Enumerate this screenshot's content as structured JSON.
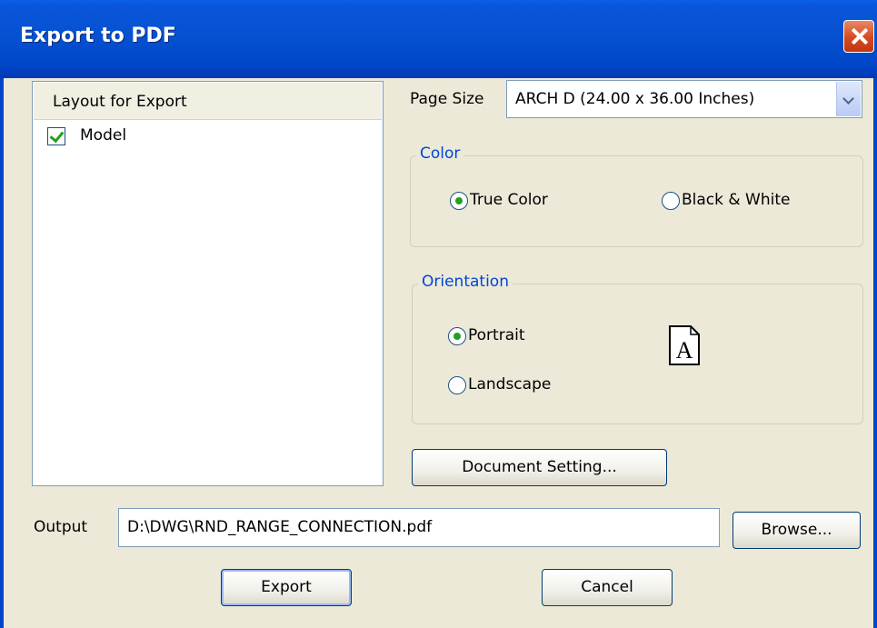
{
  "window": {
    "title": "Export to PDF"
  },
  "layout_list": {
    "header": "Layout for Export",
    "items": [
      {
        "label": "Model",
        "checked": true
      }
    ]
  },
  "page_size": {
    "label": "Page Size",
    "value": "ARCH D (24.00 x 36.00 Inches)"
  },
  "color_group": {
    "legend": "Color",
    "options": [
      {
        "label": "True Color",
        "selected": true
      },
      {
        "label": "Black & White",
        "selected": false
      }
    ]
  },
  "orientation_group": {
    "legend": "Orientation",
    "options": [
      {
        "label": "Portrait",
        "selected": true
      },
      {
        "label": "Landscape",
        "selected": false
      }
    ],
    "preview_letter": "A"
  },
  "buttons": {
    "document_setting": "Document Setting...",
    "browse": "Browse...",
    "export": "Export",
    "cancel": "Cancel"
  },
  "output": {
    "label": "Output",
    "value": "D:\\DWG\\RND_RANGE_CONNECTION.pdf"
  },
  "colors": {
    "titlebar": "#0752d4",
    "group_legend": "#0046d5",
    "radio_dot": "#21a121",
    "dialog_bg": "#ece9d8"
  }
}
